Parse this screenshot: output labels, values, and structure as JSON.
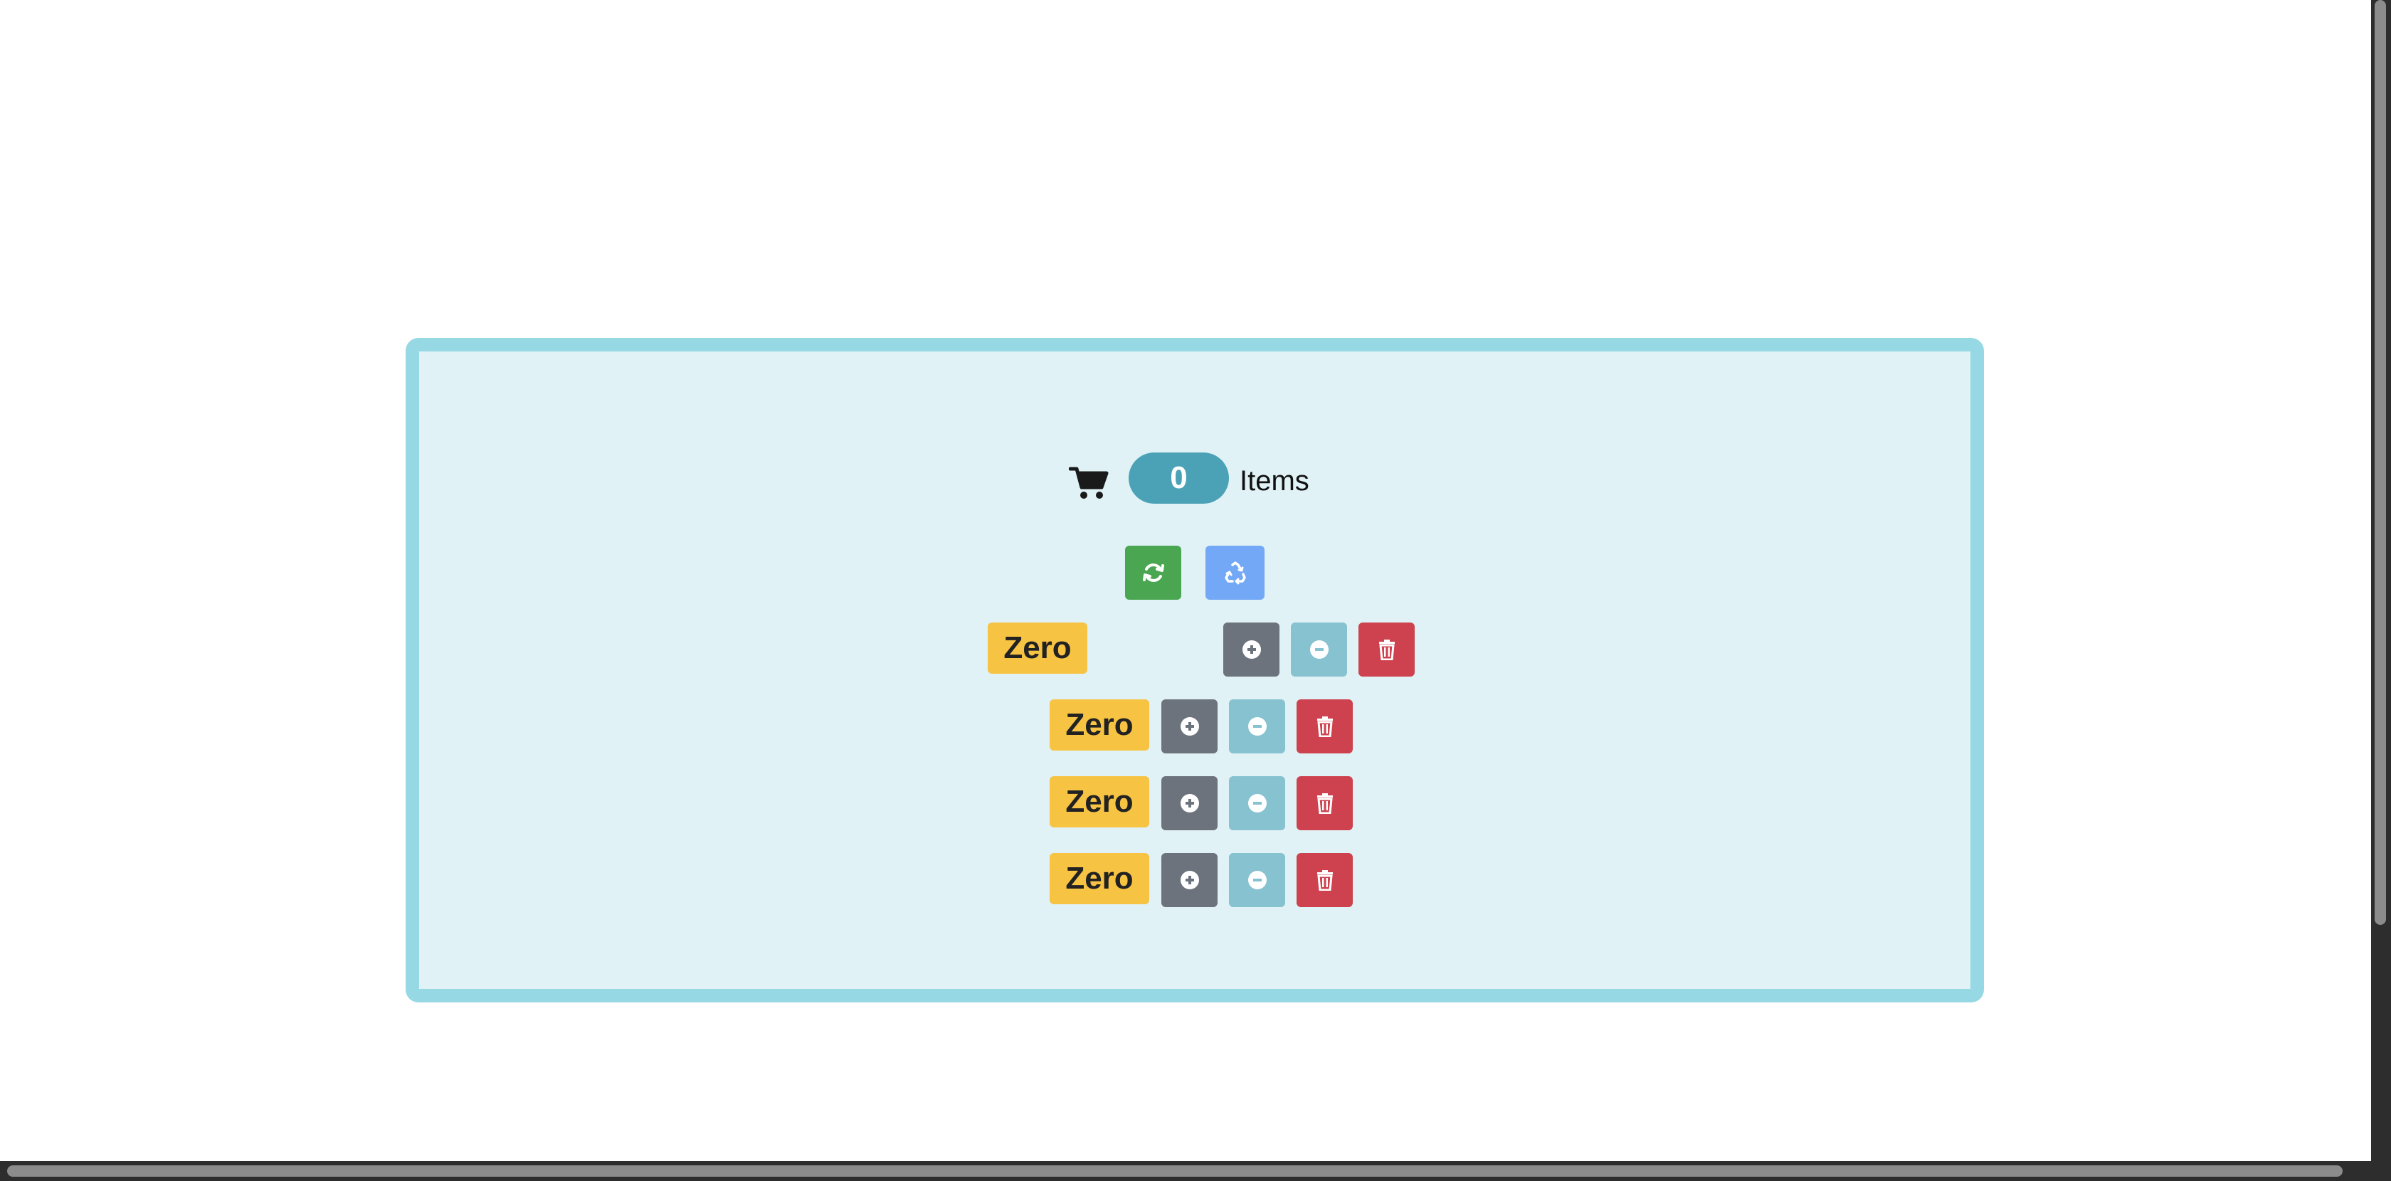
{
  "cart": {
    "icon": "shopping-cart-icon",
    "count": "0",
    "items_label": "Items"
  },
  "toolbar": {
    "refresh_icon": "refresh-icon",
    "recycle_icon": "recycle-icon"
  },
  "counters": [
    {
      "value_label": "Zero"
    },
    {
      "value_label": "Zero"
    },
    {
      "value_label": "Zero"
    },
    {
      "value_label": "Zero"
    }
  ],
  "colors": {
    "panel_border": "#96d8e4",
    "panel_background": "#e0f2f5",
    "badge_info": "#4ba2b6",
    "refresh_button": "#4aa651",
    "recycle_button": "#72a8f5",
    "plus_button": "#6c737c",
    "minus_button": "#87c2d1",
    "trash_button": "#cd424e",
    "zero_badge": "#f7c343"
  }
}
